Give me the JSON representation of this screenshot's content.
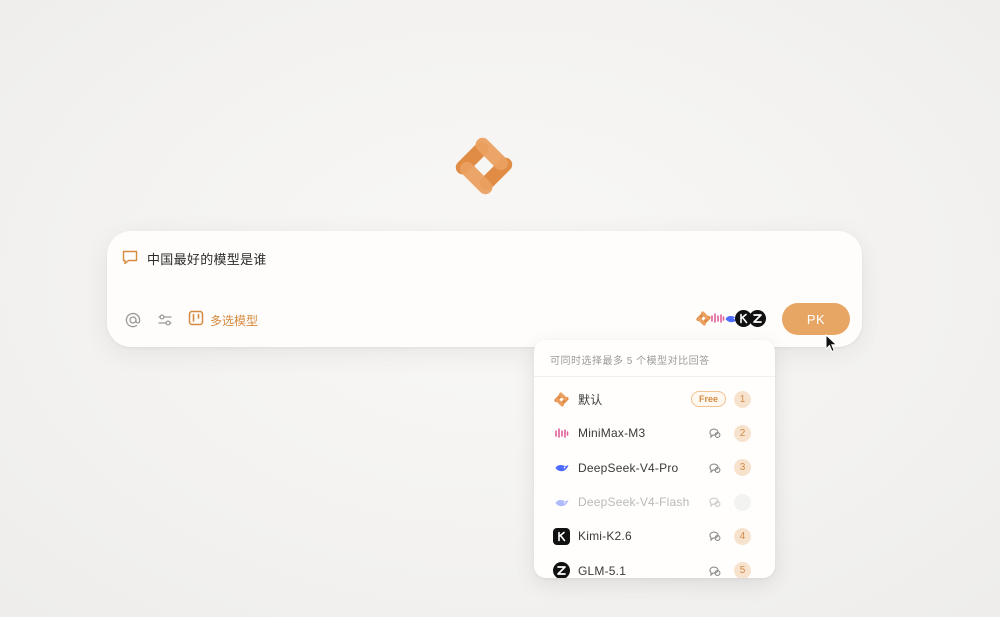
{
  "app": {
    "logo_icon": "brand-logo-icon"
  },
  "chat": {
    "prompt_icon": "chat-bubble-icon",
    "prompt_text": "中国最好的模型是谁",
    "tools": {
      "at_icon": "at-mention-icon",
      "settings_icon": "sliders-icon",
      "multi_select_icon": "kanban-icon",
      "multi_select_label": "多选模型"
    },
    "selected_models_icons": [
      "brand-logo-icon",
      "minimax-icon",
      "deepseek-icon",
      "kimi-icon",
      "glm-icon"
    ],
    "pk_label": "PK"
  },
  "dropdown": {
    "header": "可同时选择最多 5 个模型对比回答",
    "items": [
      {
        "name": "默认",
        "icon": "brand-logo-icon",
        "badge": "Free",
        "number": "1",
        "disabled": false
      },
      {
        "name": "MiniMax-M3",
        "icon": "minimax-icon",
        "think": "thinking-icon",
        "number": "2",
        "disabled": false
      },
      {
        "name": "DeepSeek-V4-Pro",
        "icon": "deepseek-icon",
        "think": "thinking-icon",
        "number": "3",
        "disabled": false
      },
      {
        "name": "DeepSeek-V4-Flash",
        "icon": "deepseek-icon",
        "think": "thinking-icon",
        "number": "",
        "disabled": true
      },
      {
        "name": "Kimi-K2.6",
        "icon": "kimi-icon",
        "think": "thinking-icon",
        "number": "4",
        "disabled": false
      },
      {
        "name": "GLM-5.1",
        "icon": "glm-icon",
        "think": "thinking-icon",
        "number": "5",
        "disabled": false
      }
    ]
  },
  "colors": {
    "accent": "#e8a664",
    "accent_text": "#d58a3f",
    "badge_bg": "#f7e3cd"
  }
}
